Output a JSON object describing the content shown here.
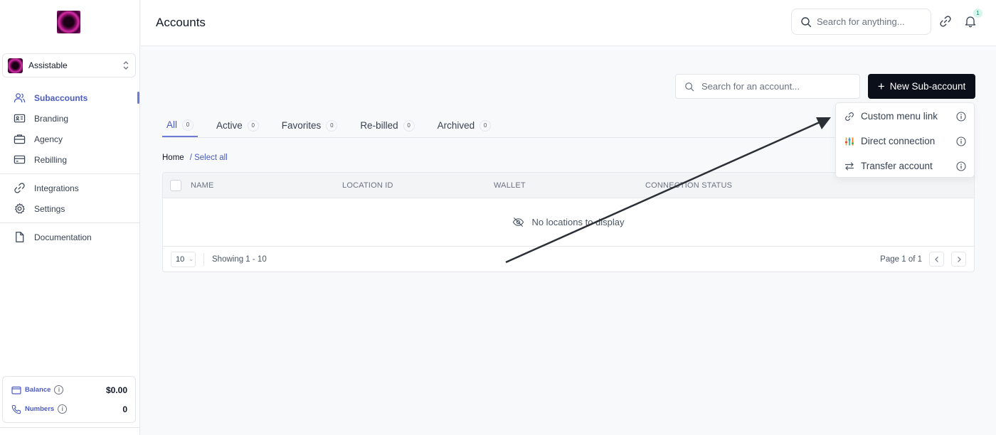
{
  "sidebar": {
    "workspace": "Assistable",
    "nav": [
      {
        "label": "Subaccounts",
        "icon": "users-icon",
        "active": true
      },
      {
        "label": "Branding",
        "icon": "id-card-icon"
      },
      {
        "label": "Agency",
        "icon": "briefcase-icon"
      },
      {
        "label": "Rebilling",
        "icon": "credit-card-icon"
      },
      {
        "label": "Integrations",
        "icon": "link-icon"
      },
      {
        "label": "Settings",
        "icon": "gear-icon"
      },
      {
        "label": "Documentation",
        "icon": "document-icon"
      }
    ],
    "balance": {
      "label": "Balance",
      "value": "$0.00"
    },
    "numbers": {
      "label": "Numbers",
      "value": "0"
    }
  },
  "header": {
    "title": "Accounts",
    "search_placeholder": "Search for anything...",
    "notification_count": "1"
  },
  "toolbar": {
    "account_search_placeholder": "Search for an account...",
    "new_button_label": "New Sub-account"
  },
  "tabs": [
    {
      "label": "All",
      "count": "0",
      "active": true
    },
    {
      "label": "Active",
      "count": "0"
    },
    {
      "label": "Favorites",
      "count": "0"
    },
    {
      "label": "Re-billed",
      "count": "0"
    },
    {
      "label": "Archived",
      "count": "0"
    }
  ],
  "breadcrumb": {
    "home": "Home",
    "select_all": "/ Select all"
  },
  "table": {
    "columns": [
      "NAME",
      "LOCATION ID",
      "WALLET",
      "CONNECTION STATUS"
    ],
    "empty_text": "No locations to display",
    "page_size": "10",
    "showing": "Showing 1 - 10",
    "page_of": "Page 1 of 1"
  },
  "dropdown": {
    "items": [
      {
        "label": "Custom menu link",
        "icon": "link-icon"
      },
      {
        "label": "Direct connection",
        "icon": "equalizer-icon"
      },
      {
        "label": "Transfer account",
        "icon": "transfer-arrows-icon"
      }
    ]
  },
  "colors": {
    "accent": "#4b5bbf",
    "primary_button": "#0b0f1a"
  }
}
